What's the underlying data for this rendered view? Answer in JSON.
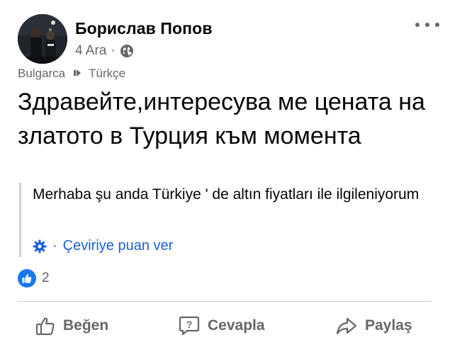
{
  "post": {
    "author": "Борислав Попов",
    "date": "4 Ara",
    "separator": "·",
    "privacy_icon": "globe-icon",
    "more_icon": "more-dots-icon"
  },
  "translation_info": {
    "source_lang": "Bulgarca",
    "target_lang": "Türkçe"
  },
  "content": {
    "original_text": "Здравейте,интересува ме цената на златото в Турция към момента",
    "translated_text": "Merhaba şu anda Türkiye ' de altın fiyatları ile ilgileniyorum",
    "rate_separator": "·",
    "rate_label": "Çeviriye puan ver"
  },
  "reactions": {
    "like_count": "2"
  },
  "actions": {
    "like_label": "Beğen",
    "reply_label": "Cevapla",
    "share_label": "Paylaş"
  },
  "colors": {
    "accent": "#1877f2",
    "link": "#1a5fd6",
    "muted": "#65676b"
  }
}
